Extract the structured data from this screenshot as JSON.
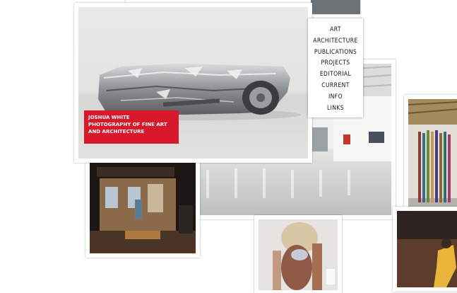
{
  "site": {
    "photographer": "JOSHUA WHITE",
    "tagline_line1": "PHOTOGRAPHY OF FINE ART",
    "tagline_line2": "AND ARCHITECTURE"
  },
  "nav": {
    "items": [
      {
        "label": "ART"
      },
      {
        "label": "ARCHITECTURE"
      },
      {
        "label": "PUBLICATIONS"
      },
      {
        "label": "PROJECTS"
      },
      {
        "label": "EDITORIAL"
      },
      {
        "label": "CURRENT"
      },
      {
        "label": "INFO"
      },
      {
        "label": "LINKS"
      }
    ]
  },
  "colors": {
    "badge": "#d8192b",
    "gallery_floor": "#cfd0ce"
  }
}
